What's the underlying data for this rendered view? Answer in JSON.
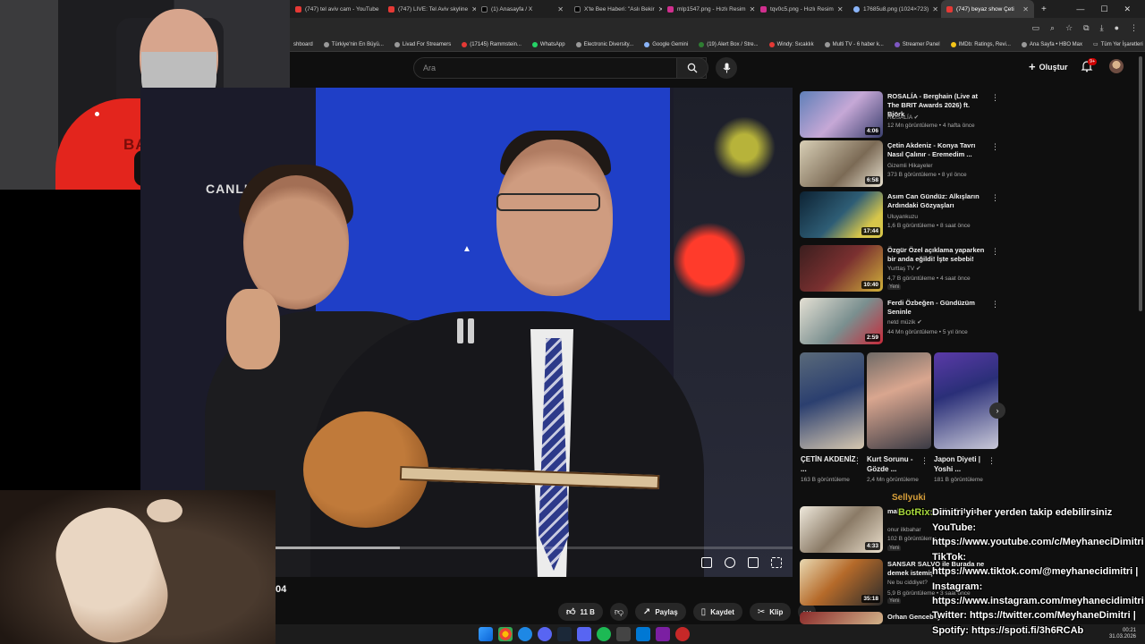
{
  "tabs": [
    {
      "title": "(747) tel aviv cam - YouTube",
      "icon": "youtube"
    },
    {
      "title": "(747) LIVE: Tel Aviv skyline",
      "icon": "youtube"
    },
    {
      "title": "(1) Anasayfa / X",
      "icon": "x"
    },
    {
      "title": "X'te Bee Haberi: \"Aslı Bekir",
      "icon": "x"
    },
    {
      "title": "mlp1547.png - Hızlı Resim",
      "icon": "pink"
    },
    {
      "title": "tqv0c5.png - Hızlı Resim",
      "icon": "pink"
    },
    {
      "title": "17685u8.png (1024×723)",
      "icon": "globe"
    },
    {
      "title": "(747) beyaz show Çeti",
      "icon": "youtube"
    }
  ],
  "bookmarks": [
    "shboard",
    "Türkiye'nin En Büyü...",
    "Livad For Streamers",
    "(17145) Rammstein...",
    "WhatsApp",
    "Electronic Diversity...",
    "Google Gemini",
    "(19) Alert Box / Stre...",
    "Windy: Sıcaklık",
    "Multi TV - 6 haber k...",
    "Streamer Panel",
    "IMDb: Ratings, Revi...",
    "Ana Sayfa • HBO Max"
  ],
  "bookmarks_all": "Tüm Yer İşaretleri",
  "header": {
    "search_placeholder": "Ara",
    "create_label": "Oluştur",
    "notif_count": "9+"
  },
  "video": {
    "overlay_text": "CANLI",
    "time_fragment": "04",
    "progress": 0.24
  },
  "actions": {
    "like_count": "11 B",
    "share": "Paylaş",
    "save": "Kaydet",
    "clip": "Klip"
  },
  "sidebar": [
    {
      "title": "ROSALÍA - Berghain (Live at The BRIT Awards 2026) ft. Björk",
      "channel": "ROSALÍA ✔",
      "meta": "12 Mn görüntüleme • 4 hafta önce",
      "duration": "4:06",
      "is_new": ""
    },
    {
      "title": "Çetin Akdeniz - Konya Tavrı Nasıl Çalınır - Eremedim ...",
      "channel": "Gizemli Hikayeler",
      "meta": "373 B görüntüleme • 8 yıl önce",
      "duration": "6:58",
      "is_new": ""
    },
    {
      "title": "Asım Can Gündüz: Alkışların Ardındaki Gözyaşları",
      "channel": "Uluyankuzu",
      "meta": "1,6 B görüntüleme • 8 saat önce",
      "duration": "17:44",
      "is_new": ""
    },
    {
      "title": "Özgür Özel açıklama yaparken bir anda eğildi! İşte sebebi!",
      "channel": "Yurttaş TV ✔",
      "meta": "4,7 B görüntüleme • 4 saat önce",
      "duration": "10:40",
      "is_new": "Yeni"
    },
    {
      "title": "Ferdi Özbeğen - Gündüzüm Seninle",
      "channel": "netd müzik ✔",
      "meta": "44 Mn görüntüleme • 5 yıl önce",
      "duration": "2:59",
      "is_new": ""
    },
    {
      "title": "malatyalı ... müziği çalışması",
      "channel": "onur ilkbahar",
      "meta": "102 B görüntüleme",
      "duration": "4:33",
      "is_new": "Yeni"
    },
    {
      "title": "SANSAR SALVO ile Burada ne demek istemiş",
      "channel": "Ne bu ciddiyet?",
      "meta": "5,9 B görüntüleme • 3 saat önce",
      "duration": "35:18",
      "is_new": "Yeni"
    },
    {
      "title": "Orhan Gencebay...",
      "channel": "",
      "meta": "",
      "duration": "",
      "is_new": ""
    }
  ],
  "shorts": [
    {
      "title": "ÇETİN AKDENİZ ...",
      "views": "163 B görüntüleme"
    },
    {
      "title": "Kurt Sorunu - Gözde ...",
      "views": "2,4 Mn görüntüleme"
    },
    {
      "title": "Japon Diyeti | Yoshi ...",
      "views": "181 B görüntüleme"
    }
  ],
  "overlay": {
    "chat_user": "Sellyuki",
    "botrix": "BotRix:",
    "line1": "Dimitri'yi her yerden takip edebilirsiniz",
    "youtube_label": "YouTube:",
    "youtube_url": "https://www.youtube.com/c/MeyhaneciDimitri |",
    "tiktok_label": "TikTok:",
    "tiktok_url": "https://www.tiktok.com/@meyhanecidimitri |",
    "instagram_label": "Instagram:",
    "instagram_url": "https://www.instagram.com/meyhanecidimitri |",
    "twitter": "Twitter: https://twitter.com/MeyhaneDimitri |",
    "spotify": "Spotify: https://spoti.fi/3h6RCAb",
    "shirt_text": "BAR"
  },
  "taskbar": {
    "time": "00:21",
    "date": "31.03.2026"
  }
}
